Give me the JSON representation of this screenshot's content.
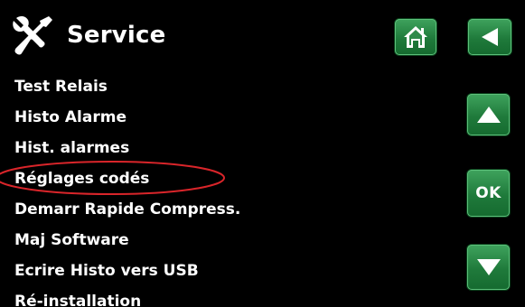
{
  "header": {
    "title": "Service",
    "icon": "tools-icon"
  },
  "menu": {
    "items": [
      {
        "label": "Test Relais"
      },
      {
        "label": "Histo Alarme"
      },
      {
        "label": "Hist. alarmes"
      },
      {
        "label": "Réglages codés"
      },
      {
        "label": "Demarr Rapide Compress."
      },
      {
        "label": "Maj Software"
      },
      {
        "label": "Ecrire Histo vers USB"
      },
      {
        "label": "Ré-installation"
      }
    ]
  },
  "buttons": {
    "home_icon": "home-icon",
    "back_icon": "back-arrow-icon",
    "up_icon": "arrow-up-icon",
    "ok_label": "OK",
    "down_icon": "arrow-down-icon"
  },
  "colors": {
    "background": "#000000",
    "text": "#ffffff",
    "button_green": "#1f7a3b",
    "annotation_red": "#d9252a"
  }
}
